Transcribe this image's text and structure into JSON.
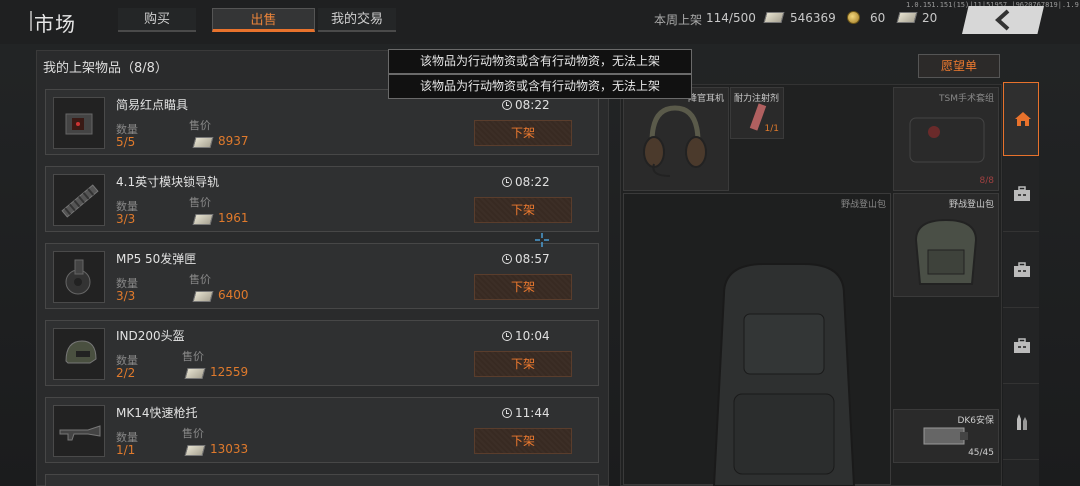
{
  "header": {
    "title": "市场",
    "tabs": [
      {
        "label": "购买",
        "active": false
      },
      {
        "label": "出售",
        "active": true
      },
      {
        "label": "我的交易",
        "active": false
      }
    ],
    "version": "1.0.151.151(15)|11|51957.|9620767819|.1.9.0",
    "weekly_listing_label": "本周上架",
    "weekly_listing_value": "114/500",
    "cash": "546369",
    "coins": "60",
    "tickets": "20"
  },
  "listings_panel": {
    "title": "我的上架物品（8/8）",
    "qty_label": "数量",
    "price_label": "售价",
    "delist_label": "下架",
    "items": [
      {
        "name": "简易红点瞄具",
        "qty": "5/5",
        "price": "8937",
        "time": "08:22",
        "icon": "red-dot-sight-icon"
      },
      {
        "name": "4.1英寸模块锁导轨",
        "qty": "3/3",
        "price": "1961",
        "time": "08:22",
        "icon": "rail-icon"
      },
      {
        "name": "MP5 50发弹匣",
        "qty": "3/3",
        "price": "6400",
        "time": "08:57",
        "icon": "drum-magazine-icon"
      },
      {
        "name": "IND200头盔",
        "qty": "2/2",
        "price": "12559",
        "time": "10:04",
        "icon": "helmet-icon"
      },
      {
        "name": "MK14快速枪托",
        "qty": "1/1",
        "price": "13033",
        "time": "11:44",
        "icon": "rifle-stock-icon"
      }
    ]
  },
  "tooltips": [
    "该物品为行动物资或含有行动物资，无法上架",
    "该物品为行动物资或含有行动物资，无法上架"
  ],
  "inventory": {
    "wishlist_label": "愿望单",
    "headset_label": "降官耳机",
    "syringe_label": "耐力注射剂",
    "syringe_count": "1/1",
    "tsm_label": "TSM手术套组",
    "tsm_count": "8/8",
    "backpack_large_label": "野战登山包",
    "backpack_small_label": "野战登山包",
    "safe_label": "DK6安保",
    "safe_count": "45/45"
  },
  "sidebar": {
    "items": [
      "home-icon",
      "case-icon",
      "case-icon",
      "case-icon",
      "ammo-icon"
    ]
  },
  "colors": {
    "accent": "#e8722c",
    "text": "#d4d4d4",
    "background": "#1c1d1e"
  }
}
